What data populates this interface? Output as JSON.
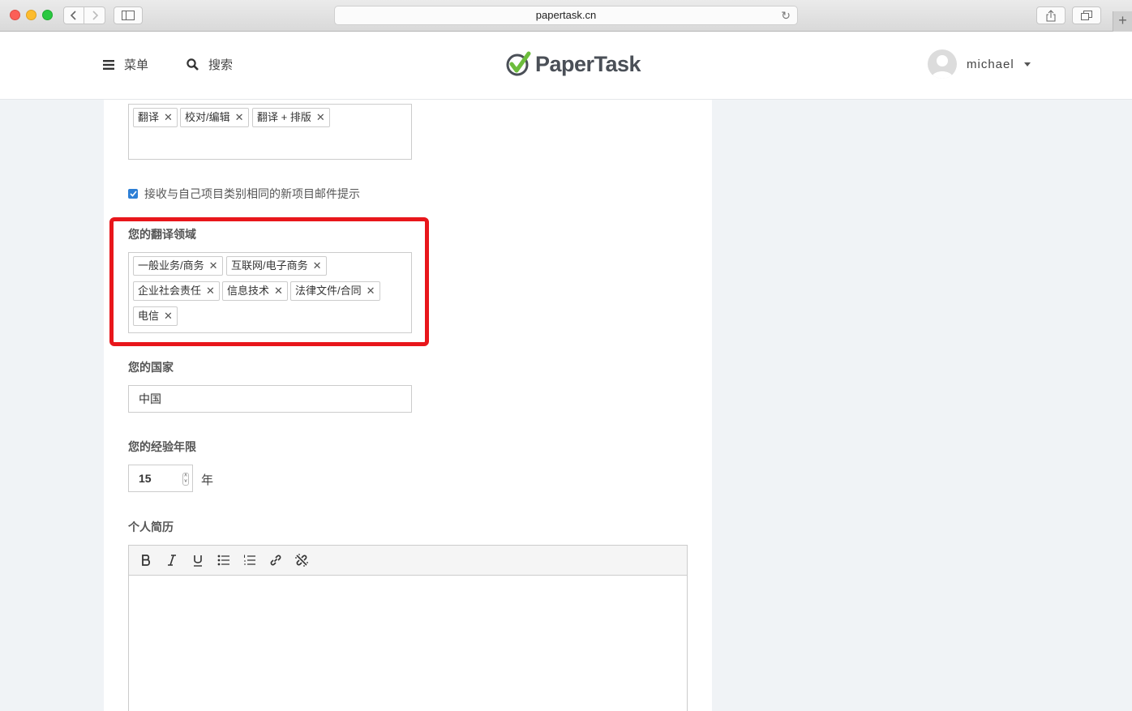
{
  "browser": {
    "url": "papertask.cn"
  },
  "header": {
    "menu_label": "菜单",
    "search_label": "搜索",
    "logo_text": "PaperTask",
    "username": "michael"
  },
  "project_types": {
    "tags": [
      "翻译",
      "校对/编辑",
      "翻译 + 排版"
    ]
  },
  "notify_checkbox": {
    "label": "接收与自己项目类别相同的新项目邮件提示",
    "checked": true
  },
  "fields_section": {
    "label": "您的翻译领域",
    "tags": [
      "一般业务/商务",
      "互联网/电子商务",
      "企业社会责任",
      "信息技术",
      "法律文件/合同",
      "电信"
    ]
  },
  "country": {
    "label": "您的国家",
    "value": "中国"
  },
  "experience": {
    "label": "您的经验年限",
    "value": "15",
    "unit": "年"
  },
  "resume": {
    "label": "个人简历"
  },
  "colors": {
    "highlight": "#e8161b",
    "checkbox": "#2d7fd6",
    "logo_check": "#6dbd3c"
  }
}
